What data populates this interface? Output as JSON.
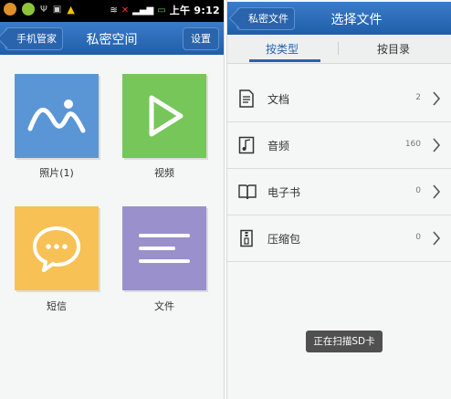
{
  "status_bar": {
    "time": "上午 9:12"
  },
  "left_screen": {
    "back_label": "手机管家",
    "title": "私密空间",
    "settings_label": "设置",
    "tiles": [
      {
        "label": "照片(1)",
        "color": "#5a96d6",
        "icon": "image-icon"
      },
      {
        "label": "视频",
        "color": "#76c65a",
        "icon": "play-icon"
      },
      {
        "label": "短信",
        "color": "#f7c156",
        "icon": "chat-icon"
      },
      {
        "label": "文件",
        "color": "#9990cc",
        "icon": "file-lines-icon"
      }
    ]
  },
  "right_screen": {
    "back_label": "私密文件",
    "title": "选择文件",
    "tabs": [
      {
        "label": "按类型",
        "active": true
      },
      {
        "label": "按目录",
        "active": false
      }
    ],
    "items": [
      {
        "label": "文档",
        "count": "2",
        "icon": "document-icon"
      },
      {
        "label": "音频",
        "count": "160",
        "icon": "audio-icon"
      },
      {
        "label": "电子书",
        "count": "0",
        "icon": "ebook-icon"
      },
      {
        "label": "压缩包",
        "count": "0",
        "icon": "archive-icon"
      }
    ],
    "toast": "正在扫描SD卡"
  }
}
